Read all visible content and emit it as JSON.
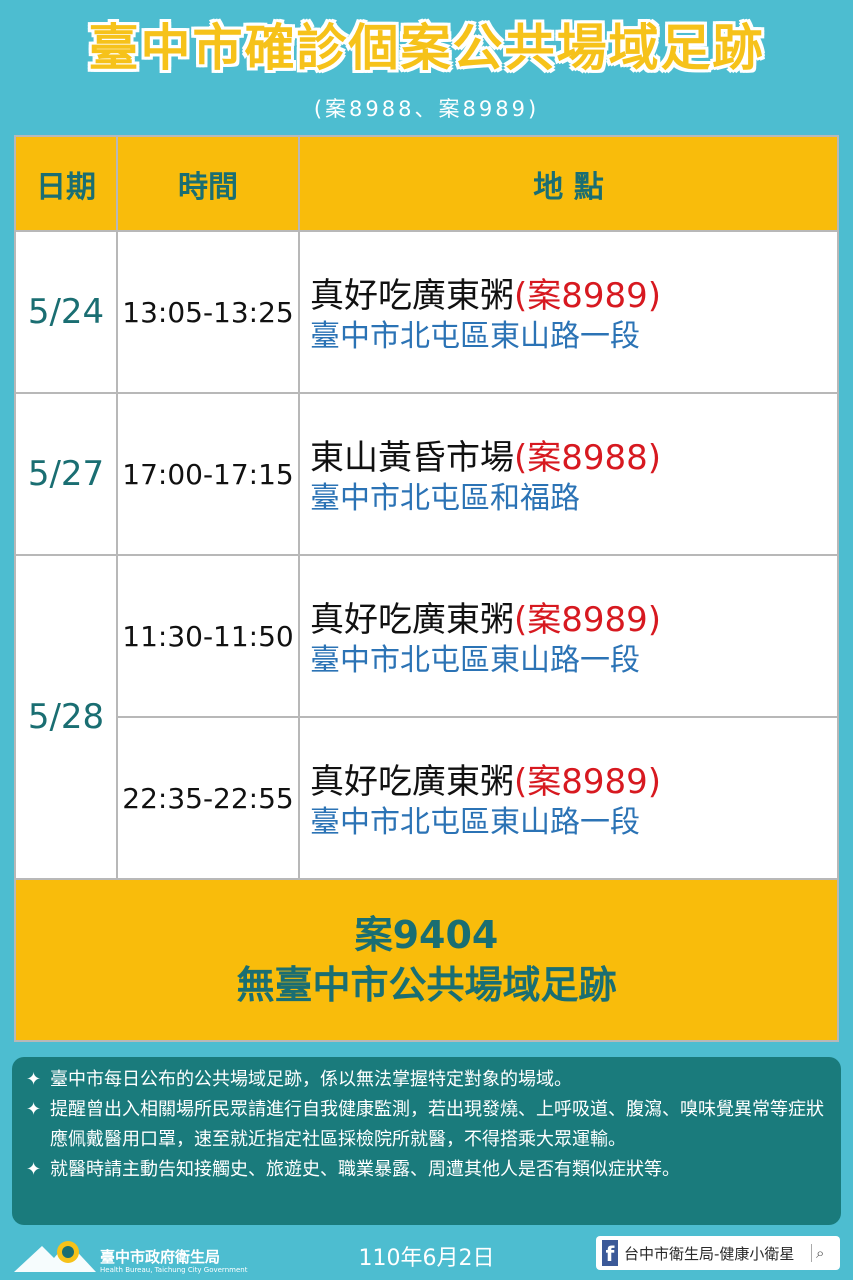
{
  "header": {
    "title": "臺中市確診個案公共場域足跡",
    "subtitle": "(案8988、案8989)"
  },
  "table": {
    "headers": [
      "日期",
      "時間",
      "地 點"
    ],
    "rows": [
      {
        "date": "5/24",
        "time": "13:05-13:25",
        "place": "真好吃廣東粥",
        "case": "(案8989)",
        "addr": "臺中市北屯區東山路一段"
      },
      {
        "date": "5/27",
        "time": "17:00-17:15",
        "place": "東山黃昏市場",
        "case": "(案8988)",
        "addr": "臺中市北屯區和福路"
      },
      {
        "date": "5/28",
        "time": "11:30-11:50",
        "place": "真好吃廣東粥",
        "case": "(案8989)",
        "addr": "臺中市北屯區東山路一段"
      },
      {
        "date": "",
        "time": "22:35-22:55",
        "place": "真好吃廣東粥",
        "case": "(案8989)",
        "addr": "臺中市北屯區東山路一段"
      }
    ],
    "bottom_line1": "案9404",
    "bottom_line2": "無臺中市公共場域足跡"
  },
  "notes": [
    "臺中市每日公布的公共場域足跡，係以無法掌握特定對象的場域。",
    "提醒曾出入相關場所民眾請進行自我健康監測，若出現發燒、上呼吸道、腹瀉、嗅味覺異常等症狀應佩戴醫用口罩，速至就近指定社區採檢院所就醫，不得搭乘大眾運輸。",
    "就醫時請主動告知接觸史、旅遊史、職業暴露、周遭其他人是否有類似症狀等。"
  ],
  "note_star": "✦",
  "footer": {
    "org_name": "臺中市政府衛生局",
    "org_en": "Health Bureau, Taichung City Government",
    "date": "110年6月2日",
    "fb_letter": "f",
    "fb_label": "台中市衛生局-健康小衛星",
    "search_glyph": "⌕"
  }
}
